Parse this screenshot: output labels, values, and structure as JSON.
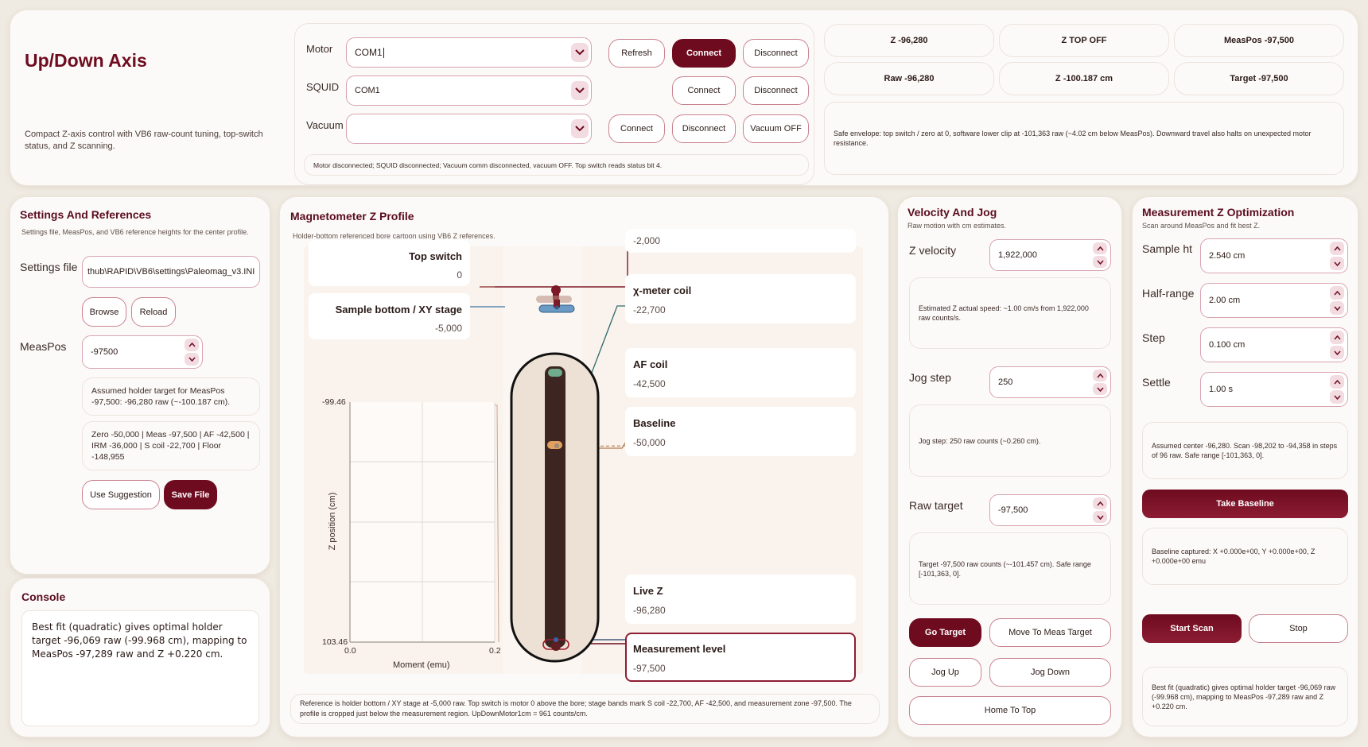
{
  "header": {
    "title": "Up/Down Axis",
    "description": "Compact Z-axis control with VB6 raw-count tuning, top-switch status, and Z scanning."
  },
  "connections": {
    "motor": {
      "label": "Motor",
      "value": "COM1",
      "refresh": "Refresh",
      "connect": "Connect",
      "disconnect": "Disconnect"
    },
    "squid": {
      "label": "SQUID",
      "value": "COM1",
      "connect": "Connect",
      "disconnect": "Disconnect"
    },
    "vacuum": {
      "label": "Vacuum",
      "value": "",
      "connect": "Connect",
      "disconnect": "Disconnect",
      "off": "Vacuum OFF"
    },
    "status": "Motor disconnected; SQUID disconnected; Vacuum comm disconnected, vacuum OFF. Top switch reads status bit 4."
  },
  "status_tiles": {
    "z": "Z -96,280",
    "ztop": "Z TOP OFF",
    "measpos": "MeasPos -97,500",
    "raw": "Raw -96,280",
    "zcm": "Z -100.187 cm",
    "target": "Target -97,500",
    "safe": "Safe envelope: top switch / zero at 0, software lower clip at -101,363 raw (~4.02 cm below MeasPos). Downward travel also halts on unexpected motor resistance."
  },
  "settings": {
    "title": "Settings And References",
    "subtitle": "Settings file, MeasPos, and VB6 reference heights for the center profile.",
    "file_label": "Settings file",
    "file_value": "thub\\RAPID\\VB6\\settings\\Paleomag_v3.INI",
    "browse": "Browse",
    "reload": "Reload",
    "measpos_label": "MeasPos",
    "measpos_value": "-97500",
    "assumed": "Assumed holder target for MeasPos -97,500: -96,280 raw (~-100.187 cm).",
    "refs": "Zero -50,000 | Meas -97,500 | AF -42,500 | IRM -36,000 | S coil -22,700 | Floor -148,955",
    "use": "Use Suggestion",
    "save": "Save File"
  },
  "console": {
    "title": "Console",
    "text": "Best fit (quadratic) gives optimal holder target -96,069 raw (-99.968 cm), mapping to MeasPos -97,289 raw and Z +0.220 cm."
  },
  "profile": {
    "title": "Magnetometer Z Profile",
    "subtitle": "Holder-bottom referenced bore cartoon using VB6 Z references.",
    "top_switch": {
      "label": "Top switch",
      "value": "0"
    },
    "sample_bottom": {
      "label": "Sample bottom / XY stage",
      "value": "-5,000"
    },
    "clip": {
      "value": "-2,000"
    },
    "chi": {
      "label": "χ-meter coil",
      "value": "-22,700"
    },
    "af": {
      "label": "AF coil",
      "value": "-42,500"
    },
    "baseline": {
      "label": "Baseline",
      "value": "-50,000"
    },
    "live": {
      "label": "Live Z",
      "value": "-96,280"
    },
    "meas": {
      "label": "Measurement level",
      "value": "-97,500"
    },
    "note": "Reference is holder bottom / XY stage at -5,000 raw. Top switch is motor 0 above the bore; stage bands mark S coil -22,700, AF -42,500, and measurement zone -97,500. The profile is cropped just below the measurement region. UpDownMotor1cm = 961 counts/cm."
  },
  "chart_data": {
    "type": "scatter",
    "xlabel": "Moment (emu)",
    "ylabel": "Z position (cm)",
    "xlim": [
      0.0,
      0.2
    ],
    "ylim": [
      "-99.46",
      "103.46"
    ],
    "x_ticks": [
      "0.0",
      "0.2"
    ],
    "y_ticks": [
      "-99.46",
      "103.46"
    ],
    "grid": true,
    "series": []
  },
  "velocity": {
    "title": "Velocity And Jog",
    "subtitle": "Raw motion with cm estimates.",
    "z_label": "Z velocity",
    "z_value": "1,922,000",
    "z_info": "Estimated Z actual speed: ~1.00 cm/s from 1,922,000 raw counts/s.",
    "jog_label": "Jog step",
    "jog_value": "250",
    "jog_info": "Jog step: 250 raw counts (~0.260 cm).",
    "raw_label": "Raw target",
    "raw_value": "-97,500",
    "raw_info": "Target -97,500 raw counts (~-101.457 cm). Safe range [-101,363, 0].",
    "go": "Go Target",
    "move": "Move To Meas Target",
    "jog_up": "Jog Up",
    "jog_down": "Jog Down",
    "home": "Home To Top"
  },
  "optim": {
    "title": "Measurement Z Optimization",
    "subtitle": "Scan around MeasPos and fit best Z.",
    "sample_label": "Sample ht",
    "sample_value": "2.540 cm",
    "half_label": "Half-range",
    "half_value": "2.00 cm",
    "step_label": "Step",
    "step_value": "0.100 cm",
    "settle_label": "Settle",
    "settle_value": "1.00 s",
    "center_info": "Assumed center -96,280. Scan -98,202 to -94,358 in steps of 96 raw. Safe range [-101,363, 0].",
    "baseline_btn": "Take Baseline",
    "baseline_info": "Baseline captured: X +0.000e+00, Y +0.000e+00, Z +0.000e+00 emu",
    "start": "Start Scan",
    "stop": "Stop",
    "result": "Best fit (quadratic) gives optimal holder target -96,069 raw (-99.968 cm), mapping to MeasPos -97,289 raw and Z +0.220 cm."
  },
  "colors": {
    "accent": "#6e0b1f",
    "background": "#f0ebe2"
  }
}
